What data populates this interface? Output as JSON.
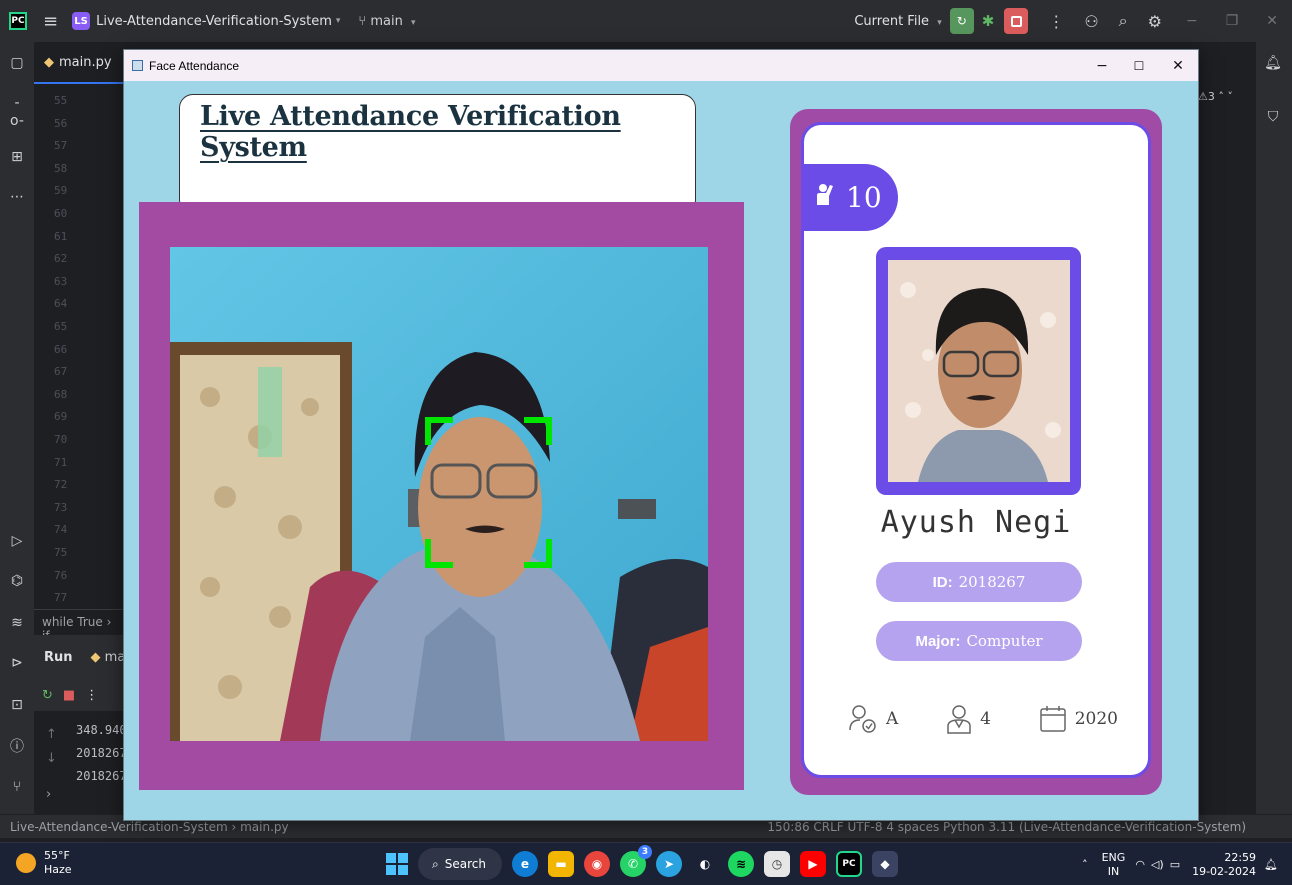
{
  "ide": {
    "project_badge": "LS",
    "project_name": "Live-Attendance-Verification-System",
    "branch": "main",
    "run_config": "Current File",
    "editor_tab": "main.py",
    "line_numbers": [
      "55",
      "56",
      "57",
      "58",
      "59",
      "60",
      "61",
      "62",
      "63",
      "64",
      "65",
      "66",
      "67",
      "68",
      "69",
      "70",
      "71",
      "72",
      "73",
      "74",
      "75",
      "76",
      "77"
    ],
    "breadcrumb": "while True  ›  if",
    "run_label": "Run",
    "run_tab": "ma",
    "warnings": "3",
    "console_lines": [
      "348.940",
      "2018267",
      "2018267"
    ]
  },
  "status_bar": {
    "path": "Live-Attendance-Verification-System  ›  main.py",
    "right": "150:86   CRLF   UTF-8   4 spaces   Python 3.11 (Live-Attendance-Verification-System)"
  },
  "window": {
    "title": "Face Attendance",
    "minimize": "−",
    "maximize": "☐",
    "close": "✕"
  },
  "app": {
    "heading": "Live Attendance Verification System",
    "attendance_count": "10",
    "student_name": "Ayush Negi",
    "id_label": "ID:",
    "id_value": "2018267",
    "major_label": "Major:",
    "major_value": "Computer",
    "standing": "A",
    "year": "4",
    "starting_year": "2020"
  },
  "taskbar": {
    "temperature": "55°F",
    "weather": "Haze",
    "search_label": "Search",
    "lang_top": "ENG",
    "lang_bottom": "IN",
    "time": "22:59",
    "date": "19-02-2024",
    "whatsapp_badge": "3"
  }
}
